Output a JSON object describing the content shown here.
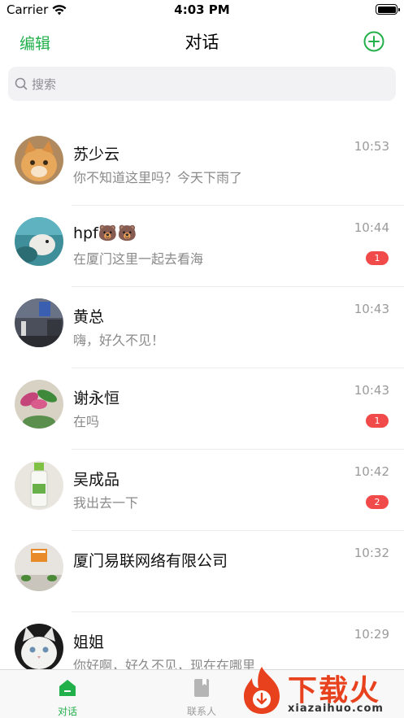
{
  "status_bar": {
    "carrier": "Carrier",
    "time": "4:03 PM"
  },
  "nav": {
    "edit_label": "编辑",
    "title": "对话",
    "add_icon": "plus-circle-icon"
  },
  "search": {
    "placeholder": "搜索"
  },
  "conversations": [
    {
      "name": "苏少云",
      "preview": "你不知道这里吗？今天下雨了",
      "time": "10:53",
      "badge": ""
    },
    {
      "name": "hpf🐻🐻",
      "preview": "在厦门这里一起去看海",
      "time": "10:44",
      "badge": "1"
    },
    {
      "name": "黄总",
      "preview": "嗨，好久不见！",
      "time": "10:43",
      "badge": ""
    },
    {
      "name": "谢永恒",
      "preview": "在吗",
      "time": "10:43",
      "badge": "1"
    },
    {
      "name": "吴成品",
      "preview": "我出去一下",
      "time": "10:42",
      "badge": "2"
    },
    {
      "name": "厦门易联网络有限公司",
      "preview": "",
      "time": "10:32",
      "badge": ""
    },
    {
      "name": "姐姐",
      "preview": "你好啊，好久不见，现在在哪里",
      "time": "10:29",
      "badge": ""
    }
  ],
  "tabs": [
    {
      "label": "对话",
      "icon": "chat-home-icon",
      "active": true
    },
    {
      "label": "联系人",
      "icon": "contacts-book-icon",
      "active": false
    }
  ],
  "watermark": {
    "text": "下载火",
    "url": "xiazaihuo.com"
  },
  "colors": {
    "accent": "#22b04b",
    "badge": "#f04a4a",
    "watermark": "#e8411e"
  }
}
